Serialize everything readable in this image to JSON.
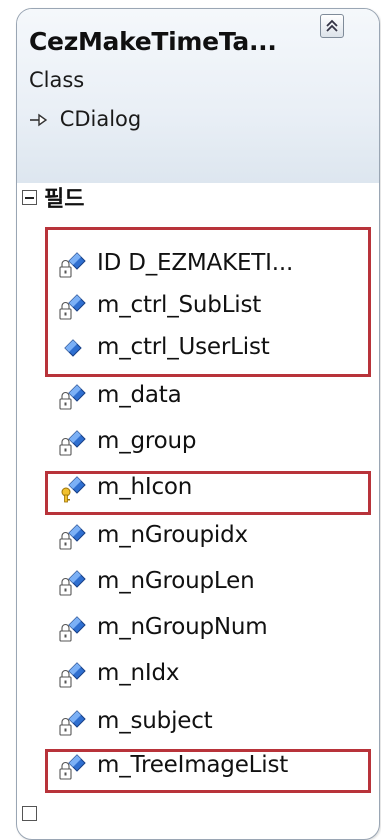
{
  "class_shape": {
    "title": "CezMakeTimeTa...",
    "kind": "Class",
    "base_class": "CDialog",
    "collapse_icon": "double-chevron-up-icon"
  },
  "fields_section": {
    "label": "필드",
    "toggle_icon": "minus-box-icon",
    "items": [
      {
        "name": "ID D_EZMAKETI...",
        "icon": "field-static-icon"
      },
      {
        "name": "m_ctrl_SubList",
        "icon": "field-icon"
      },
      {
        "name": "m_ctrl_UserList",
        "icon": "field-public-icon"
      },
      {
        "name": "m_data",
        "icon": "field-icon"
      },
      {
        "name": "m_group",
        "icon": "field-icon"
      },
      {
        "name": "m_hIcon",
        "icon": "field-protected-key-icon"
      },
      {
        "name": "m_nGroupidx",
        "icon": "field-icon"
      },
      {
        "name": "m_nGroupLen",
        "icon": "field-icon"
      },
      {
        "name": "m_nGroupNum",
        "icon": "field-icon"
      },
      {
        "name": "m_nIdx",
        "icon": "field-icon"
      },
      {
        "name": "m_subject",
        "icon": "field-icon"
      },
      {
        "name": "m_TreeImageList",
        "icon": "field-icon"
      }
    ]
  },
  "highlight_color": "#b8333a",
  "field_icon_color": "#2f6fd0"
}
